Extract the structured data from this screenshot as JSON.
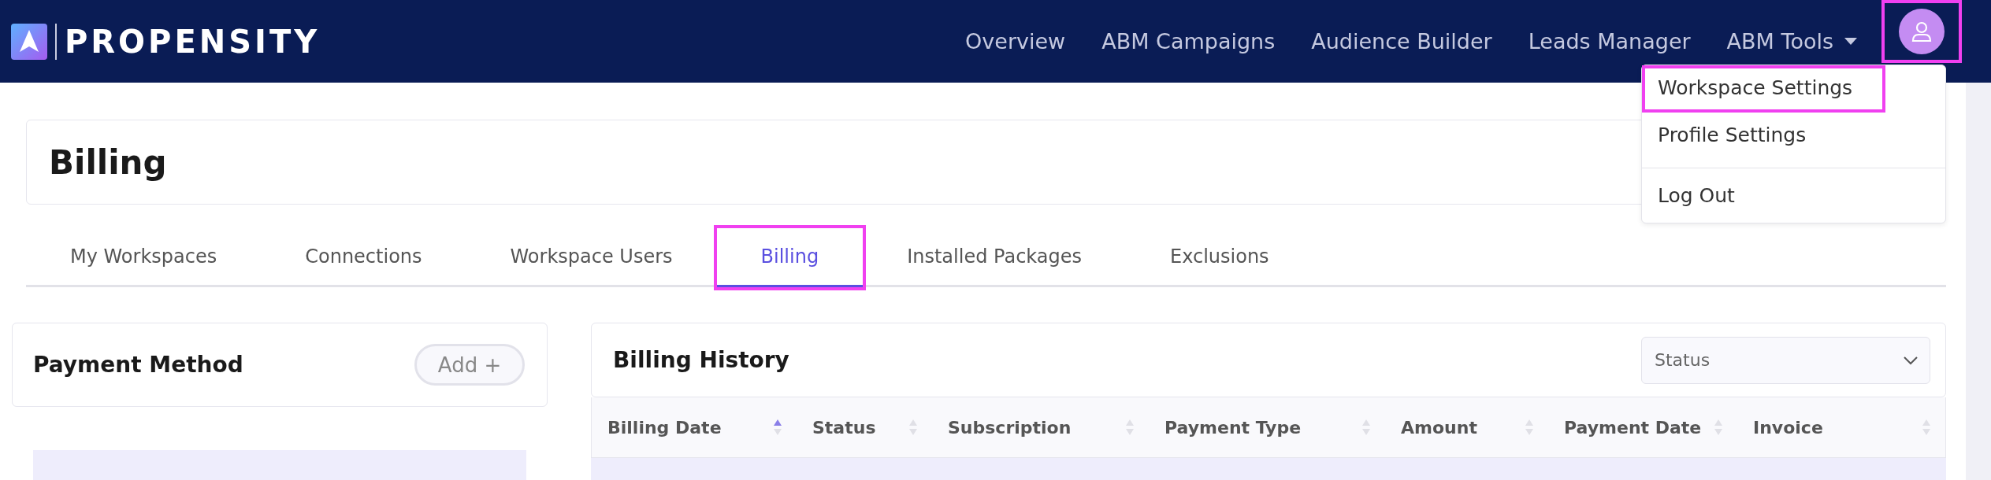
{
  "brand": {
    "name": "PROPENSITY"
  },
  "nav": {
    "items": [
      {
        "label": "Overview",
        "kind": "link"
      },
      {
        "label": "ABM Campaigns",
        "kind": "link"
      },
      {
        "label": "Audience Builder",
        "kind": "link"
      },
      {
        "label": "Leads Manager",
        "kind": "link"
      },
      {
        "label": "ABM Tools",
        "kind": "dropdown"
      }
    ],
    "avatar": {
      "highlighted": true
    }
  },
  "user_menu": {
    "expanded": true,
    "items": [
      {
        "label": "Workspace Settings",
        "highlighted": true,
        "divider_before": false
      },
      {
        "label": "Profile Settings",
        "highlighted": false,
        "divider_before": false
      },
      {
        "label": "Log Out",
        "highlighted": false,
        "divider_before": true
      }
    ]
  },
  "page": {
    "title": "Billing"
  },
  "tabs": [
    {
      "label": "My Workspaces",
      "selected": false,
      "highlighted": false
    },
    {
      "label": "Connections",
      "selected": false,
      "highlighted": false
    },
    {
      "label": "Workspace Users",
      "selected": false,
      "highlighted": false
    },
    {
      "label": "Billing",
      "selected": true,
      "highlighted": true
    },
    {
      "label": "Installed Packages",
      "selected": false,
      "highlighted": false
    },
    {
      "label": "Exclusions",
      "selected": false,
      "highlighted": false
    }
  ],
  "payment_method": {
    "title": "Payment Method",
    "add_button": "Add +"
  },
  "billing_history": {
    "title": "Billing History",
    "status_filter": {
      "placeholder": "Status"
    },
    "table": {
      "columns": [
        {
          "label": "Billing Date",
          "sorted_ascending": true
        },
        {
          "label": "Status",
          "sorted_ascending": false
        },
        {
          "label": "Subscription",
          "sorted_ascending": false
        },
        {
          "label": "Payment Type",
          "sorted_ascending": false
        },
        {
          "label": "Amount",
          "sorted_ascending": false
        },
        {
          "label": "Payment Date",
          "sorted_ascending": false
        },
        {
          "label": "Invoice",
          "sorted_ascending": false
        }
      ]
    }
  }
}
